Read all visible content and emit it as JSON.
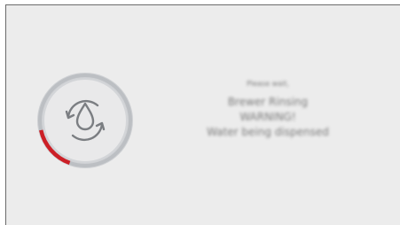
{
  "progress": {
    "fraction": 0.16,
    "accent_color": "#cc1f26",
    "ring_color": "#b9bcc0",
    "icon": "water-drop-rinse-icon"
  },
  "message": {
    "line1": "Please wait,",
    "line2": "Brewer Rinsing",
    "line3": "WARNING!",
    "line4": "Water being dispensed"
  }
}
